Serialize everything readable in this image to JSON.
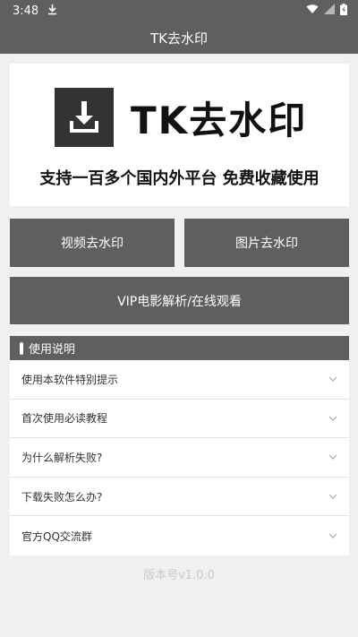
{
  "statusbar": {
    "time": "3:48"
  },
  "appbar": {
    "title": "TK去水印"
  },
  "banner": {
    "logo_text": "TK去水印",
    "slogan": "支持一百多个国内外平台 免费收藏使用"
  },
  "buttons": {
    "video": "视频去水印",
    "image": "图片去水印",
    "vip": "VIP电影解析/在线观看"
  },
  "section": {
    "title": "使用说明"
  },
  "list": [
    {
      "label": "使用本软件特别提示"
    },
    {
      "label": "首次使用必读教程"
    },
    {
      "label": "为什么解析失败?"
    },
    {
      "label": "下载失败怎么办?"
    },
    {
      "label": "官方QQ交流群"
    }
  ],
  "footer": {
    "version": "版本号v1.0.0"
  },
  "icons": [
    "download-icon",
    "wifi-icon",
    "signal-icon",
    "battery-icon",
    "download-logo-icon",
    "chevron-down-icon"
  ],
  "colors": {
    "primary": "#5f5f5f",
    "background": "#f0f0f0",
    "version_text": "#c8c8c8"
  }
}
